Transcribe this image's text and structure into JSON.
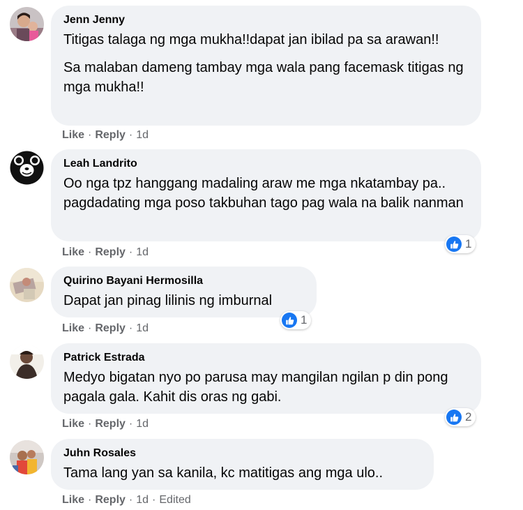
{
  "comments": [
    {
      "author": "Jenn Jenny",
      "paragraphs": [
        "Titigas talaga ng mga mukha!!dapat jan ibilad pa sa arawan!!",
        "Sa malaban dameng tambay mga wala pang facemask titigas ng mga mukha!!"
      ],
      "like_label": "Like",
      "reply_label": "Reply",
      "time": "1d"
    },
    {
      "author": "Leah Landrito",
      "paragraphs": [
        "Oo nga tpz hanggang madaling araw me mga nkatambay pa.. pagdadating mga poso takbuhan tago pag wala na balik nanman"
      ],
      "like_label": "Like",
      "reply_label": "Reply",
      "time": "1d",
      "reaction_count": "1"
    },
    {
      "author": "Quirino Bayani Hermosilla",
      "paragraphs": [
        "Dapat jan pinag lilinis ng imburnal"
      ],
      "like_label": "Like",
      "reply_label": "Reply",
      "time": "1d",
      "reaction_count": "1"
    },
    {
      "author": "Patrick Estrada",
      "paragraphs": [
        "Medyo bigatan nyo po parusa may mangilan ngilan p din pong pagala gala. Kahit dis oras ng gabi."
      ],
      "like_label": "Like",
      "reply_label": "Reply",
      "time": "1d",
      "reaction_count": "2"
    },
    {
      "author": "Juhn Rosales",
      "paragraphs": [
        "Tama lang yan sa kanila, kc matitigas ang mga ulo.."
      ],
      "like_label": "Like",
      "reply_label": "Reply",
      "time": "1d",
      "edited_label": "Edited"
    }
  ],
  "colors": {
    "bubble": "#f0f2f5",
    "like_blue": "#1877f2",
    "meta_gray": "#65676b",
    "text": "#050505"
  },
  "icons": {
    "reaction": "like-thumb-icon"
  }
}
